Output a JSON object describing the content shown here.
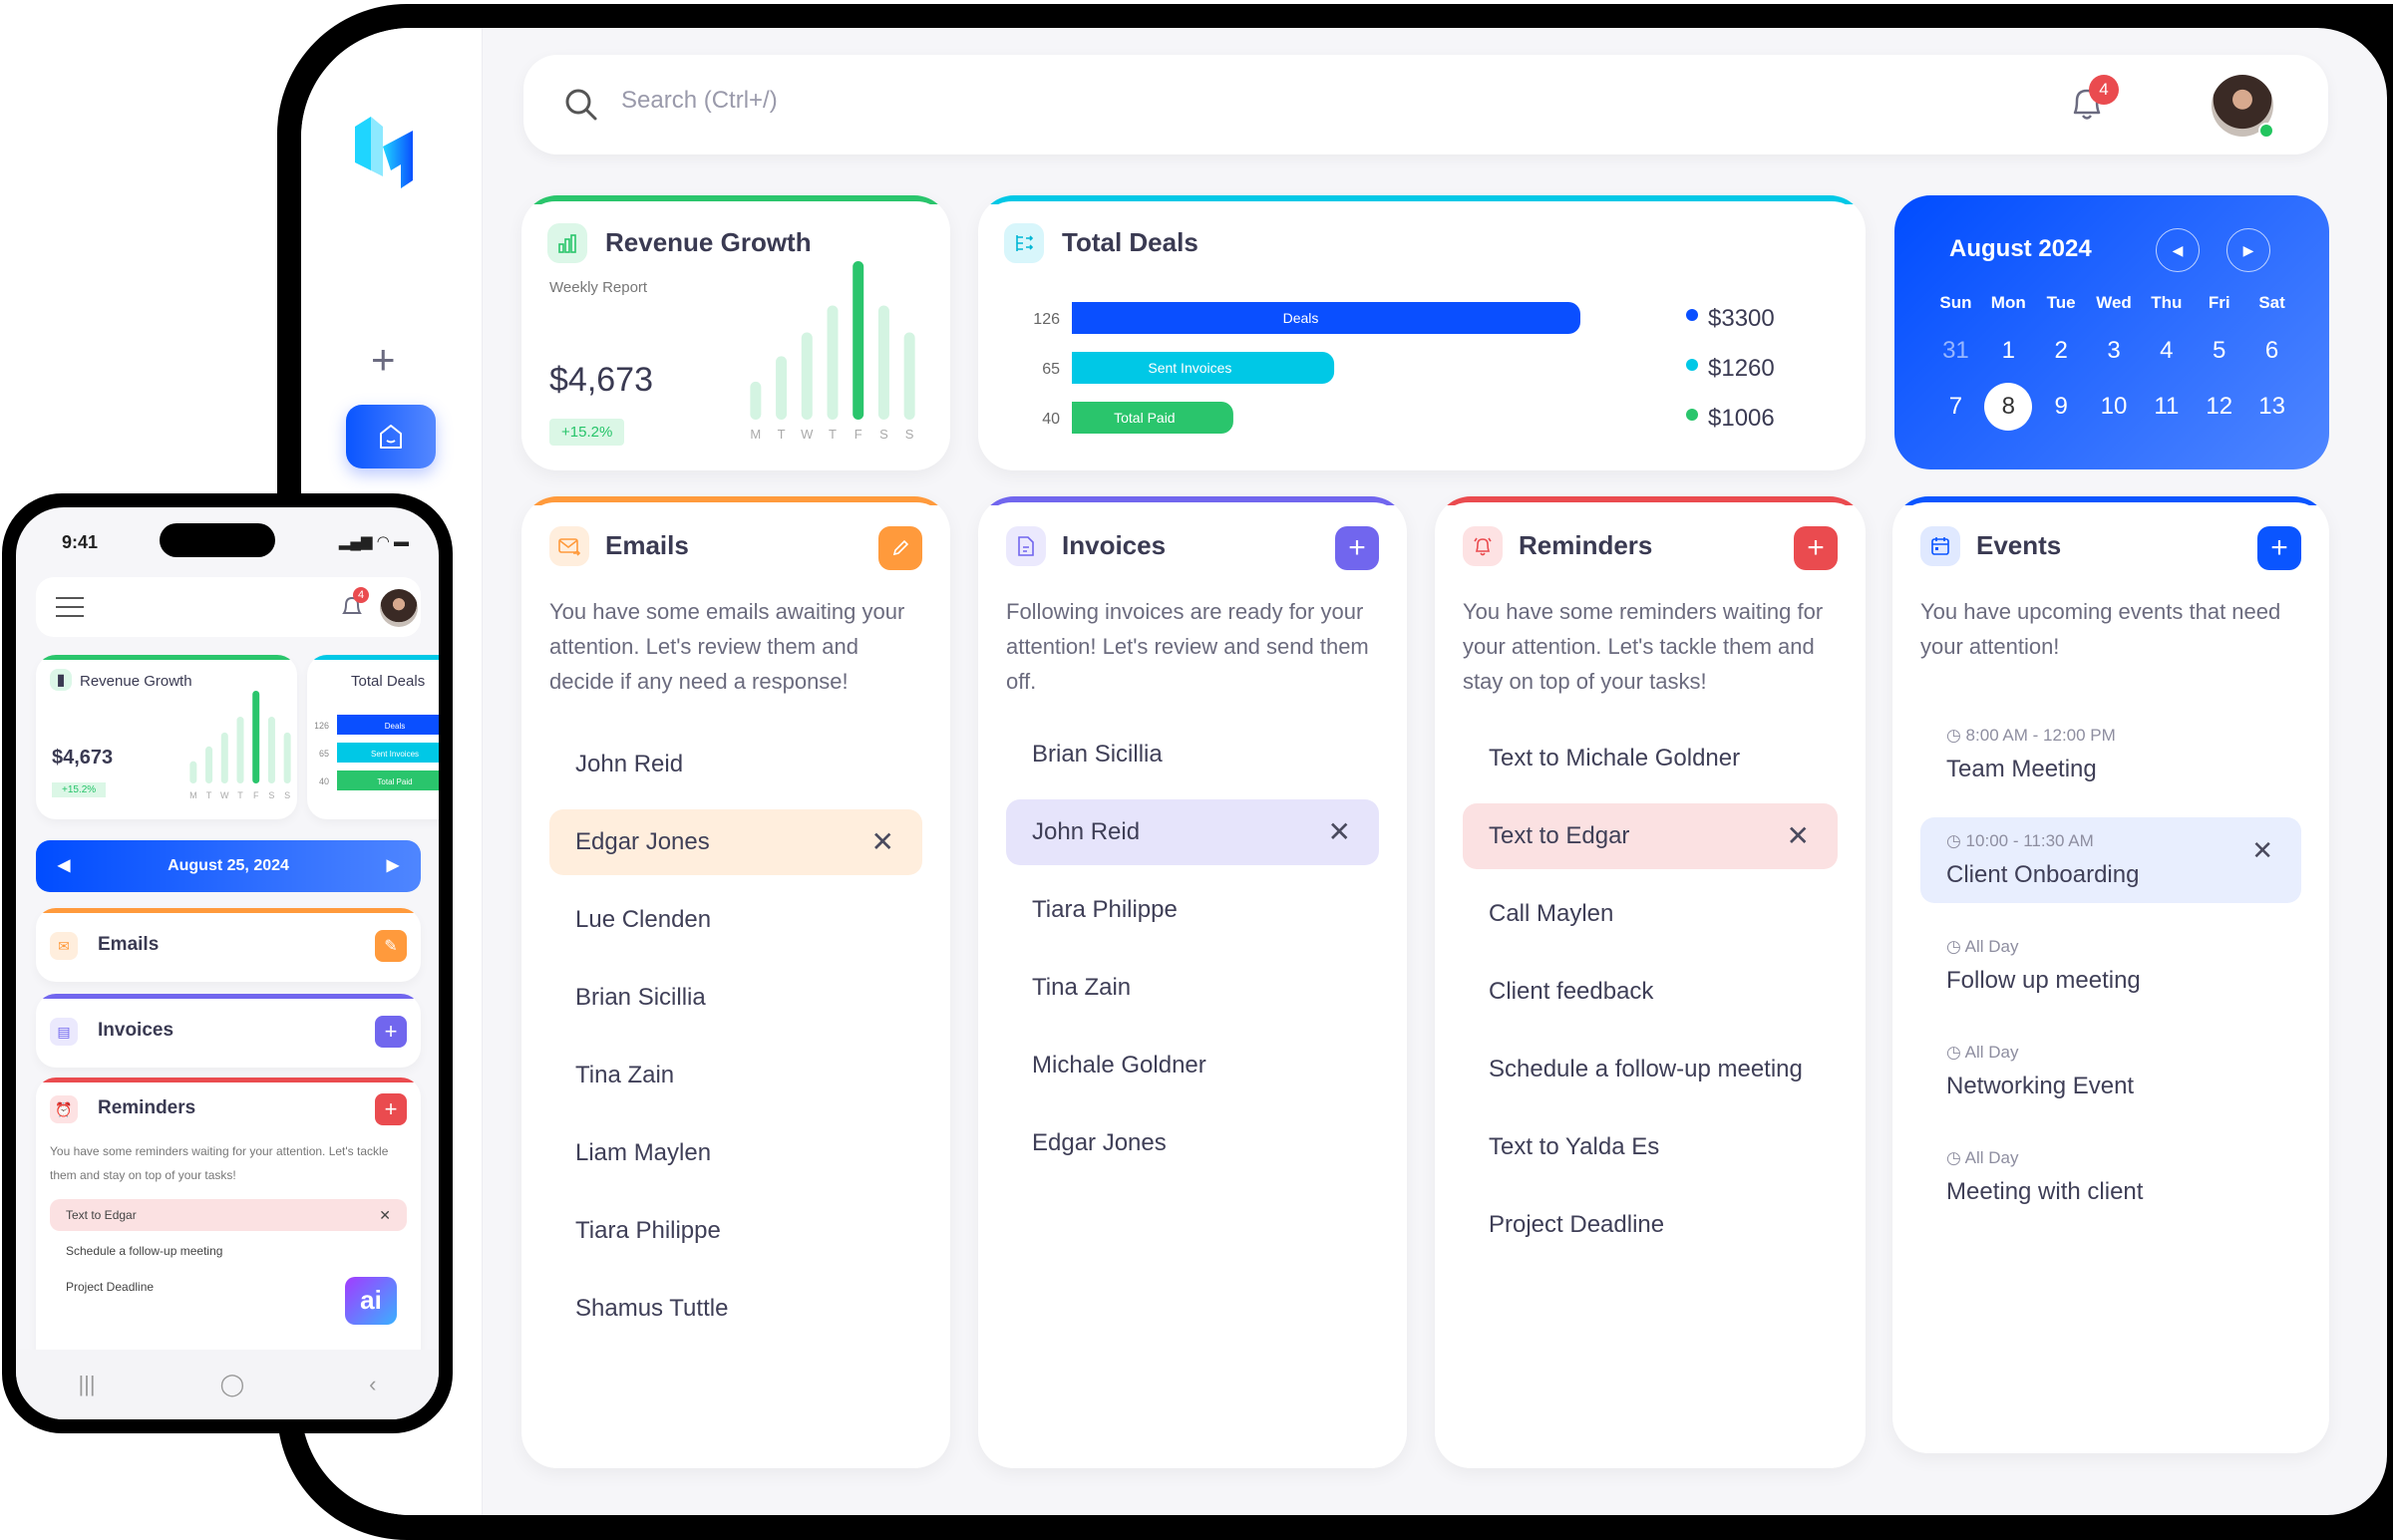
{
  "search": {
    "placeholder": "Search (Ctrl+/)"
  },
  "header": {
    "notification_count": "4"
  },
  "sidebar": {
    "add_label": "+",
    "home_icon": "home-icon"
  },
  "revenue": {
    "title": "Revenue Growth",
    "subtitle": "Weekly Report",
    "value": "$4,673",
    "change": "+15.2%",
    "accent": "#2ac56c"
  },
  "deals": {
    "title": "Total Deals",
    "accent": "#00c8e6"
  },
  "calendar": {
    "title": "August 2024",
    "prev_label": "◀",
    "next_label": "▶",
    "weekdays": [
      "Sun",
      "Mon",
      "Tue",
      "Wed",
      "Thu",
      "Fri",
      "Sat"
    ],
    "days": [
      "31",
      "1",
      "2",
      "3",
      "4",
      "5",
      "6",
      "7",
      "8",
      "9",
      "10",
      "11",
      "12",
      "13"
    ],
    "selected": "8",
    "muted": [
      "31"
    ]
  },
  "emails": {
    "title": "Emails",
    "accent": "#ff9a3c",
    "description": "You have some emails awaiting your attention. Let's review them and decide if any need a response!",
    "items": [
      "John Reid",
      "Edgar Jones",
      "Lue Clenden",
      "Brian Sicillia",
      "Tina Zain",
      "Liam Maylen",
      "Tiara Philippe",
      "Shamus Tuttle"
    ],
    "selected_index": 1
  },
  "invoices": {
    "title": "Invoices",
    "accent": "#7166ee",
    "description": "Following invoices are ready for your attention! Let's review and send them off.",
    "items": [
      "Brian Sicillia",
      "John Reid",
      "Tiara Philippe",
      "Tina Zain",
      "Michale Goldner",
      "Edgar Jones"
    ],
    "selected_index": 1
  },
  "reminders": {
    "title": "Reminders",
    "accent": "#ea4b4f",
    "description": "You have some reminders waiting for your attention. Let's tackle them and stay on top of your tasks!",
    "items": [
      "Text to Michale Goldner",
      "Text to Edgar",
      "Call Maylen",
      "Client feedback",
      "Schedule a follow-up meeting",
      "Text to Yalda Es",
      "Project Deadline"
    ],
    "selected_index": 1
  },
  "events": {
    "title": "Events",
    "accent": "#0a55ff",
    "description": "You have upcoming events that need your attention!",
    "items": [
      {
        "time": "8:00 AM - 12:00 PM",
        "title": "Team Meeting"
      },
      {
        "time": "10:00 - 11:30 AM",
        "title": "Client Onboarding"
      },
      {
        "time": "All Day",
        "title": "Follow up meeting"
      },
      {
        "time": "All Day",
        "title": "Networking Event"
      },
      {
        "time": "All Day",
        "title": "Meeting with client"
      }
    ],
    "selected_index": 1
  },
  "phone": {
    "time": "9:41",
    "status_icons": "signal wifi battery",
    "notification_count": "4",
    "date_label": "August 25, 2024",
    "revenue_title": "Revenue Growth",
    "revenue_value": "$4,673",
    "revenue_change": "+15.2%",
    "deals_title": "Total Deals",
    "emails_title": "Emails",
    "invoices_title": "Invoices",
    "reminders_title": "Reminders",
    "reminders_desc": "You have some reminders waiting for your attention. Let's tackle them and stay on top of your tasks!",
    "reminder_items": [
      "Text to Edgar",
      "Schedule a follow-up meeting",
      "Project Deadline"
    ],
    "ai_label": "ai"
  },
  "chart_data": [
    {
      "type": "bar",
      "title": "Revenue Growth",
      "categories": [
        "M",
        "T",
        "W",
        "T",
        "F",
        "S",
        "S"
      ],
      "values": [
        24,
        40,
        55,
        72,
        100,
        72,
        55
      ],
      "highlight_index": 4,
      "xlabel": "",
      "ylabel": "",
      "ylim": [
        0,
        100
      ]
    },
    {
      "type": "bar",
      "orientation": "horizontal",
      "title": "Total Deals",
      "categories": [
        "Deals",
        "Sent Invoices",
        "Total Paid"
      ],
      "values": [
        126,
        65,
        40
      ],
      "amounts": [
        "$3300",
        "$1260",
        "$1006"
      ],
      "colors": [
        "#0a4fff",
        "#00c8e6",
        "#2ac56c"
      ],
      "xlim": [
        0,
        126
      ]
    }
  ]
}
